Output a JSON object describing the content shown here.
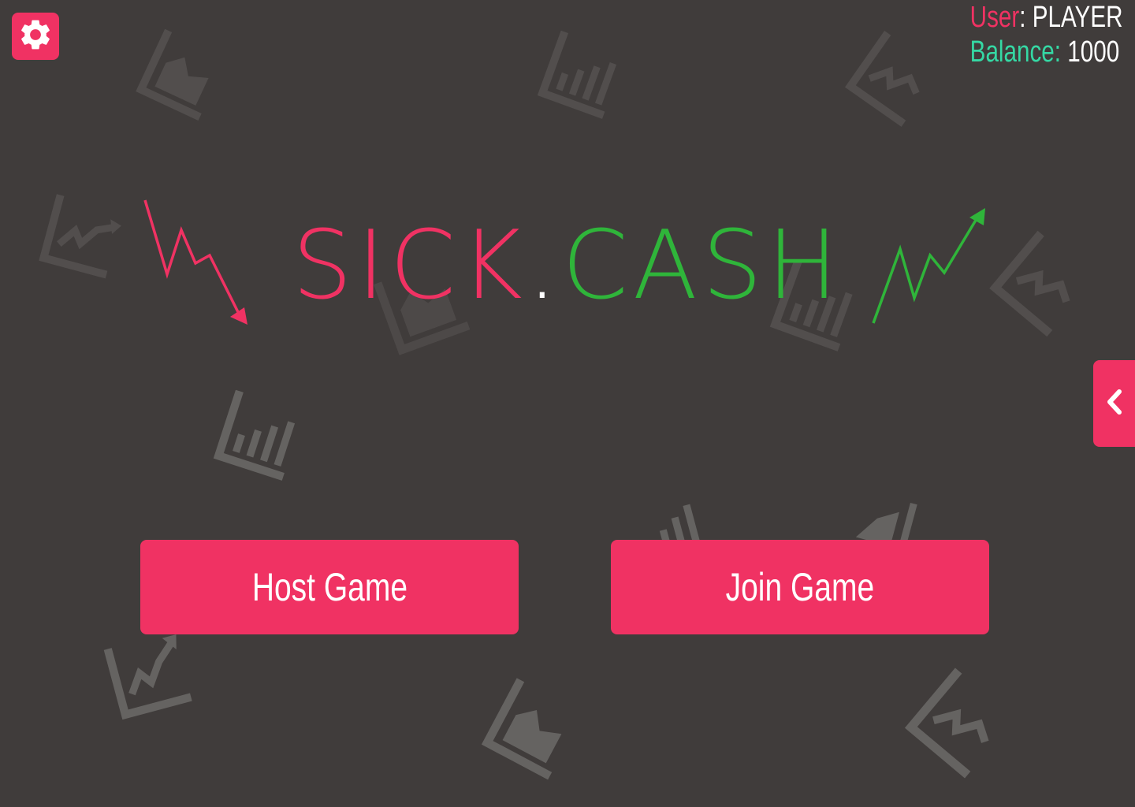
{
  "header": {
    "user_label": "User",
    "user_sep": ": ",
    "user_value": "PLAYER",
    "balance_label": "Balance:",
    "balance_value": "1000"
  },
  "logo": {
    "left": "SICK",
    "dot": ".",
    "right": "CASH"
  },
  "buttons": {
    "host": "Host Game",
    "join": "Join Game"
  },
  "icons": {
    "settings": "gear-icon",
    "side_tab": "chevron-left-icon",
    "arrow_down": "trend-down-arrow-icon",
    "arrow_up": "trend-up-arrow-icon"
  },
  "colors": {
    "background": "#403c3b",
    "accent": "#f03263",
    "balance": "#35d8a4",
    "green": "#2fb53a",
    "bg_icon": "#6a6866"
  }
}
